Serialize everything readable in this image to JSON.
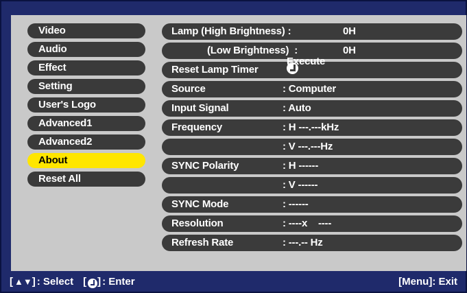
{
  "menu": {
    "items": [
      {
        "label": "Video"
      },
      {
        "label": "Audio"
      },
      {
        "label": "Effect"
      },
      {
        "label": "Setting"
      },
      {
        "label": "User's Logo"
      },
      {
        "label": "Advanced1"
      },
      {
        "label": "Advanced2"
      },
      {
        "label": "About",
        "selected": true
      },
      {
        "label": "Reset All"
      }
    ]
  },
  "about": {
    "lamp_high_label": "Lamp (High Brightness) :",
    "lamp_high_value": "0H",
    "lamp_low_label": "(Low Brightness)  :",
    "lamp_low_value": "0H",
    "reset_lamp_label": "Reset Lamp Timer",
    "reset_lamp_action": "Execute",
    "source_label": "Source",
    "source_value": ": Computer",
    "input_signal_label": "Input Signal",
    "input_signal_value": ": Auto",
    "frequency_label": "Frequency",
    "frequency_h_value": ": H ---.---kHz",
    "frequency_v_value": ": V ---.---Hz",
    "sync_polarity_label": "SYNC Polarity",
    "sync_polarity_h_value": ": H ------",
    "sync_polarity_v_value": ": V ------",
    "sync_mode_label": "SYNC Mode",
    "sync_mode_value": ": ------",
    "resolution_label": "Resolution",
    "resolution_value": ": ----x    ----",
    "refresh_rate_label": "Refresh Rate",
    "refresh_rate_value": ": ---.-- Hz"
  },
  "footer": {
    "select_hint": ": Select",
    "enter_hint": ": Enter",
    "exit_hint": "[Menu]: Exit"
  },
  "colors": {
    "background": "#1f2a6b",
    "panel": "#c9c9c9",
    "pill": "#3a3a3a",
    "selected": "#ffe600"
  },
  "icons": {
    "enter": "enter-button-icon",
    "updown": "up-down-arrow-icon",
    "right_arrow": "right-arrow-icon"
  }
}
